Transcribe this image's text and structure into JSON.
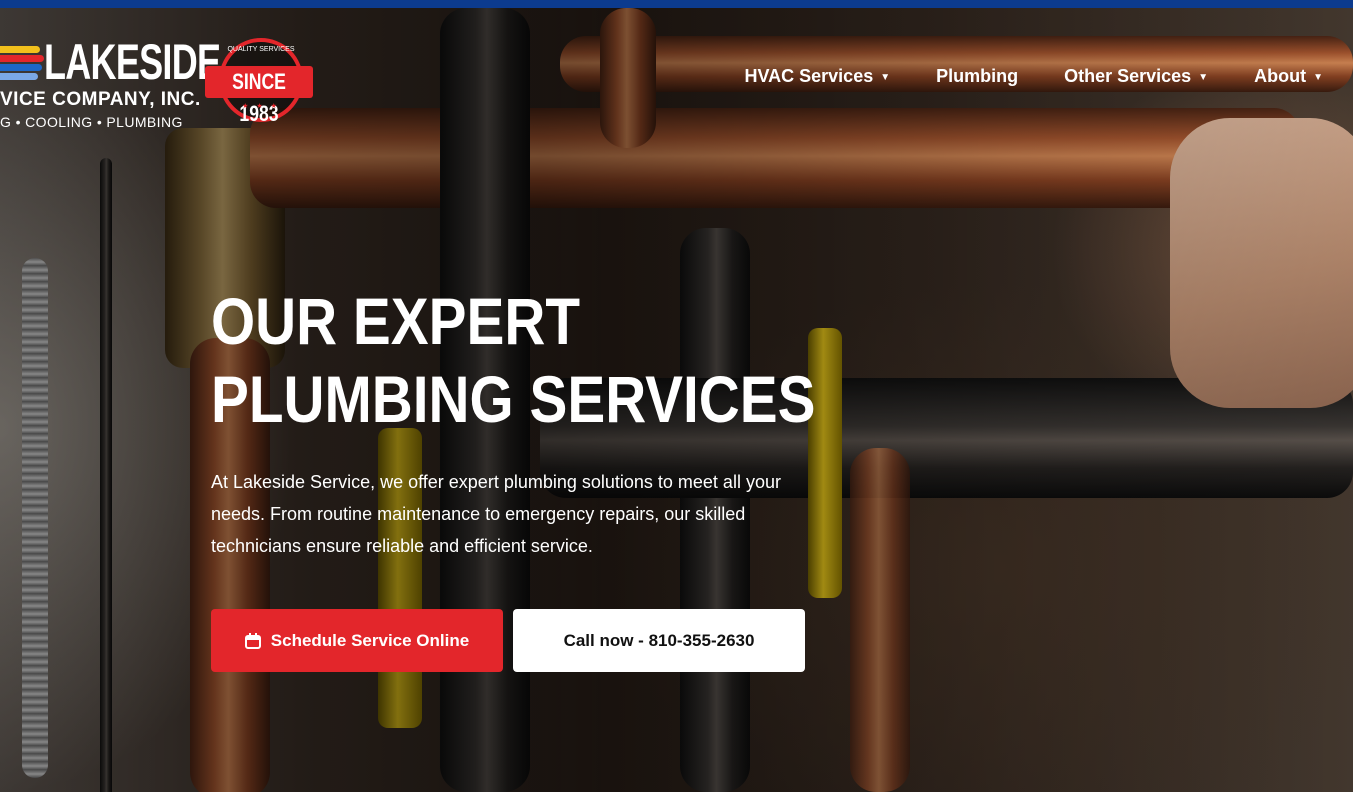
{
  "brand": {
    "logo_name": "LAKESIDE",
    "logo_company": "VICE COMPANY, INC.",
    "logo_tagline": "G • COOLING • PLUMBING",
    "badge_arc": "QUALITY SERVICES",
    "badge_main": "SINCE 1983",
    "badge_stars": "★ ★ ★",
    "stripe_colors": [
      "#f2c01c",
      "#e3262b",
      "#1c67c8",
      "#7aa8e6"
    ]
  },
  "nav": {
    "items": [
      {
        "label": "HVAC Services",
        "has_dropdown": true,
        "icon": "caret-down-icon"
      },
      {
        "label": "Plumbing",
        "has_dropdown": false
      },
      {
        "label": "Other Services",
        "has_dropdown": true,
        "icon": "caret-down-icon"
      },
      {
        "label": "About",
        "has_dropdown": true,
        "icon": "caret-down-icon"
      }
    ],
    "caret": "▼"
  },
  "hero": {
    "headline_line1": "OUR EXPERT",
    "headline_line2": "PLUMBING SERVICES",
    "description": "At Lakeside Service, we offer expert plumbing solutions to meet all your needs. From routine maintenance to emergency repairs, our skilled technicians ensure reliable and efficient service.",
    "background_image": "plumber working on copper pipes"
  },
  "cta": {
    "schedule_label": "Schedule Service Online",
    "schedule_icon": "calendar-icon",
    "call_label": "Call now - 810-355-2630"
  },
  "colors": {
    "accent_red": "#e3262b",
    "top_strip": "#0c3b8e",
    "text_light": "#ffffff"
  }
}
